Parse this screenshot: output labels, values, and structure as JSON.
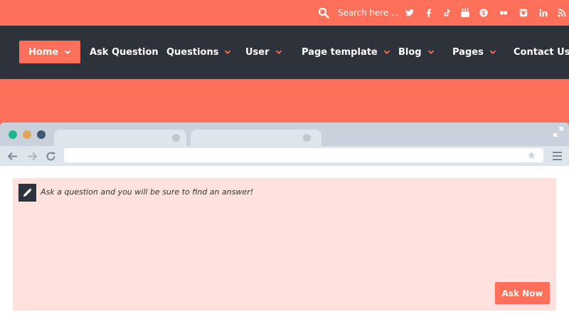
{
  "topbar": {
    "search_placeholder": "Search here ...",
    "socials": [
      "twitter-icon",
      "facebook-icon",
      "tiktok-icon",
      "youtube-icon",
      "skype-icon",
      "flickr-icon",
      "instagram-icon",
      "linkedin-icon",
      "rss-icon"
    ]
  },
  "nav": {
    "items": [
      {
        "label": "Home",
        "dropdown": true,
        "active": true
      },
      {
        "label": "Ask Question",
        "dropdown": false
      },
      {
        "label": "Questions",
        "dropdown": true
      },
      {
        "label": "User",
        "dropdown": true
      },
      {
        "label": "Page template",
        "dropdown": true
      },
      {
        "label": "Blog",
        "dropdown": true
      },
      {
        "label": "Pages",
        "dropdown": true
      },
      {
        "label": "Contact Us",
        "dropdown": false
      }
    ]
  },
  "ask": {
    "prompt": "Ask a question and you will be sure to find an answer!",
    "button_label": "Ask Now"
  },
  "colors": {
    "accent": "#ff705b",
    "navbar": "#2e323b",
    "ask_bg": "#ffe2dd"
  }
}
